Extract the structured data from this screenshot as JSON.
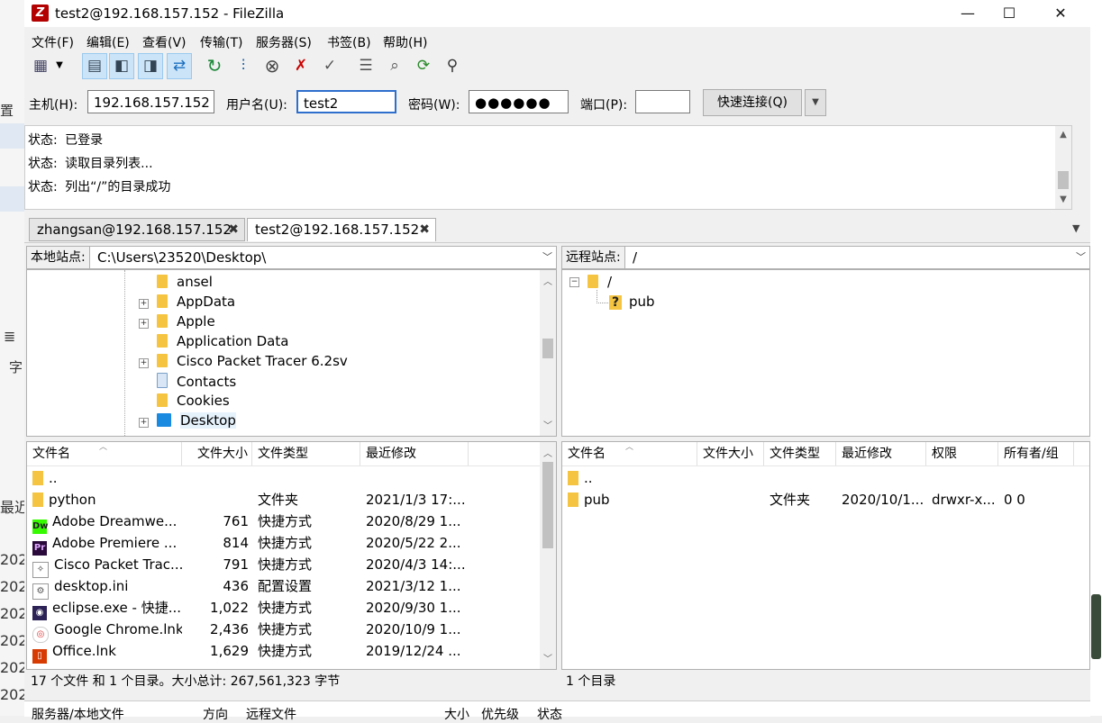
{
  "window": {
    "title": "test2@192.168.157.152 - FileZilla",
    "app_icon_letter": "Z",
    "minimize": "—",
    "maximize": "☐",
    "close": "✕"
  },
  "background_window": {
    "fragments": [
      "置",
      "字",
      "最近",
      "202",
      "202",
      "202",
      "202",
      "202",
      "202"
    ]
  },
  "menu": [
    "文件(F)",
    "编辑(E)",
    "查看(V)",
    "传输(T)",
    "服务器(S)",
    "书签(B)",
    "帮助(H)"
  ],
  "toolbar": {
    "icons": [
      "site-manager-icon",
      "dropdown-arrow-icon",
      "message-log-icon",
      "local-tree-icon",
      "remote-tree-icon",
      "transfer-queue-icon",
      "refresh-icon",
      "process-queue-icon",
      "cancel-icon",
      "disconnect-icon",
      "reconnect-icon",
      "directory-listing-filter-icon",
      "compare-icon",
      "sync-browse-icon",
      "search-icon"
    ]
  },
  "quickconnect": {
    "host_label": "主机(H):",
    "host_value": "192.168.157.152",
    "user_label": "用户名(U):",
    "user_value": "test2",
    "pass_label": "密码(W):",
    "pass_value": "●●●●●●",
    "port_label": "端口(P):",
    "port_value": "",
    "connect_button": "快速连接(Q)"
  },
  "log": {
    "lines": [
      {
        "label": "状态:",
        "text": "已登录"
      },
      {
        "label": "状态:",
        "text": "读取目录列表..."
      },
      {
        "label": "状态:",
        "text": "列出“/”的目录成功"
      }
    ]
  },
  "tabs": [
    {
      "label": "zhangsan@192.168.157.152",
      "active": false
    },
    {
      "label": "test2@192.168.157.152",
      "active": true
    }
  ],
  "local": {
    "site_label": "本地站点:",
    "path": "C:\\Users\\23520\\Desktop\\",
    "tree": [
      "ansel",
      "AppData",
      "Apple",
      "Application Data",
      "Cisco Packet Tracer 6.2sv",
      "Contacts",
      "Cookies",
      "Desktop"
    ],
    "columns": [
      "文件名",
      "文件大小",
      "文件类型",
      "最近修改"
    ],
    "files": [
      {
        "name": "..",
        "size": "",
        "type": "",
        "modified": ""
      },
      {
        "name": "python",
        "size": "",
        "type": "文件夹",
        "modified": "2021/1/3 17:..."
      },
      {
        "name": "Adobe Dreamwe...",
        "size": "761",
        "type": "快捷方式",
        "modified": "2020/8/29 1..."
      },
      {
        "name": "Adobe Premiere ...",
        "size": "814",
        "type": "快捷方式",
        "modified": "2020/5/22 2..."
      },
      {
        "name": "Cisco Packet Trac...",
        "size": "791",
        "type": "快捷方式",
        "modified": "2020/4/3 14:..."
      },
      {
        "name": "desktop.ini",
        "size": "436",
        "type": "配置设置",
        "modified": "2021/3/12 1..."
      },
      {
        "name": "eclipse.exe - 快捷...",
        "size": "1,022",
        "type": "快捷方式",
        "modified": "2020/9/30 1..."
      },
      {
        "name": "Google Chrome.lnk",
        "size": "2,436",
        "type": "快捷方式",
        "modified": "2020/10/9 1..."
      },
      {
        "name": "Office.lnk",
        "size": "1,629",
        "type": "快捷方式",
        "modified": "2019/12/24 ..."
      }
    ],
    "status": "17 个文件 和 1 个目录。大小总计: 267,561,323 字节"
  },
  "remote": {
    "site_label": "远程站点:",
    "path": "/",
    "tree": [
      "/",
      "pub"
    ],
    "columns": [
      "文件名",
      "文件大小",
      "文件类型",
      "最近修改",
      "权限",
      "所有者/组"
    ],
    "files": [
      {
        "name": "..",
        "size": "",
        "type": "",
        "modified": "",
        "perms": "",
        "owner": ""
      },
      {
        "name": "pub",
        "size": "",
        "type": "文件夹",
        "modified": "2020/10/1...",
        "perms": "drwxr-x...",
        "owner": "0 0"
      }
    ],
    "status": "1 个目录"
  },
  "queue": {
    "columns": [
      "服务器/本地文件",
      "方向",
      "远程文件",
      "大小",
      "优先级",
      "状态"
    ]
  }
}
